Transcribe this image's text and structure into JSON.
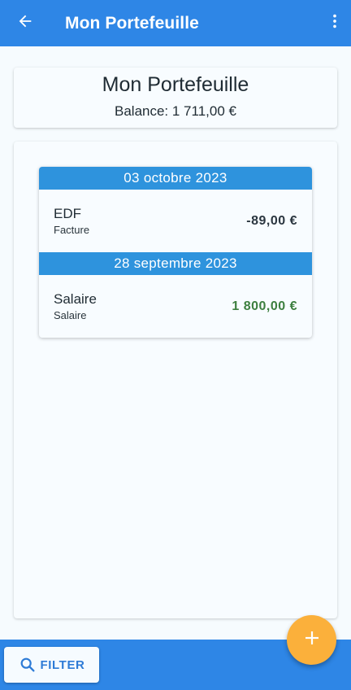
{
  "appbar": {
    "title": "Mon Portefeuille",
    "back_icon": "arrow-left-icon",
    "menu_icon": "more-vertical-icon"
  },
  "summary": {
    "name": "Mon Portefeuille",
    "balance": "Balance: 1 711,00 €"
  },
  "transactions": [
    {
      "date": "03 octobre 2023",
      "payee": "EDF",
      "category": "Facture",
      "amount": "-89,00 €",
      "type": "expense"
    },
    {
      "date": "28 septembre 2023",
      "payee": "Salaire",
      "category": "Salaire",
      "amount": "1 800,00 €",
      "type": "income"
    }
  ],
  "bottombar": {
    "filter_label": "FILTER",
    "filter_icon": "search-icon"
  },
  "fab": {
    "icon": "plus-icon"
  },
  "colors": {
    "primary": "#2e86e6",
    "date_header": "#2e93dd",
    "income": "#3d7f3f",
    "fab": "#fbb03b"
  }
}
